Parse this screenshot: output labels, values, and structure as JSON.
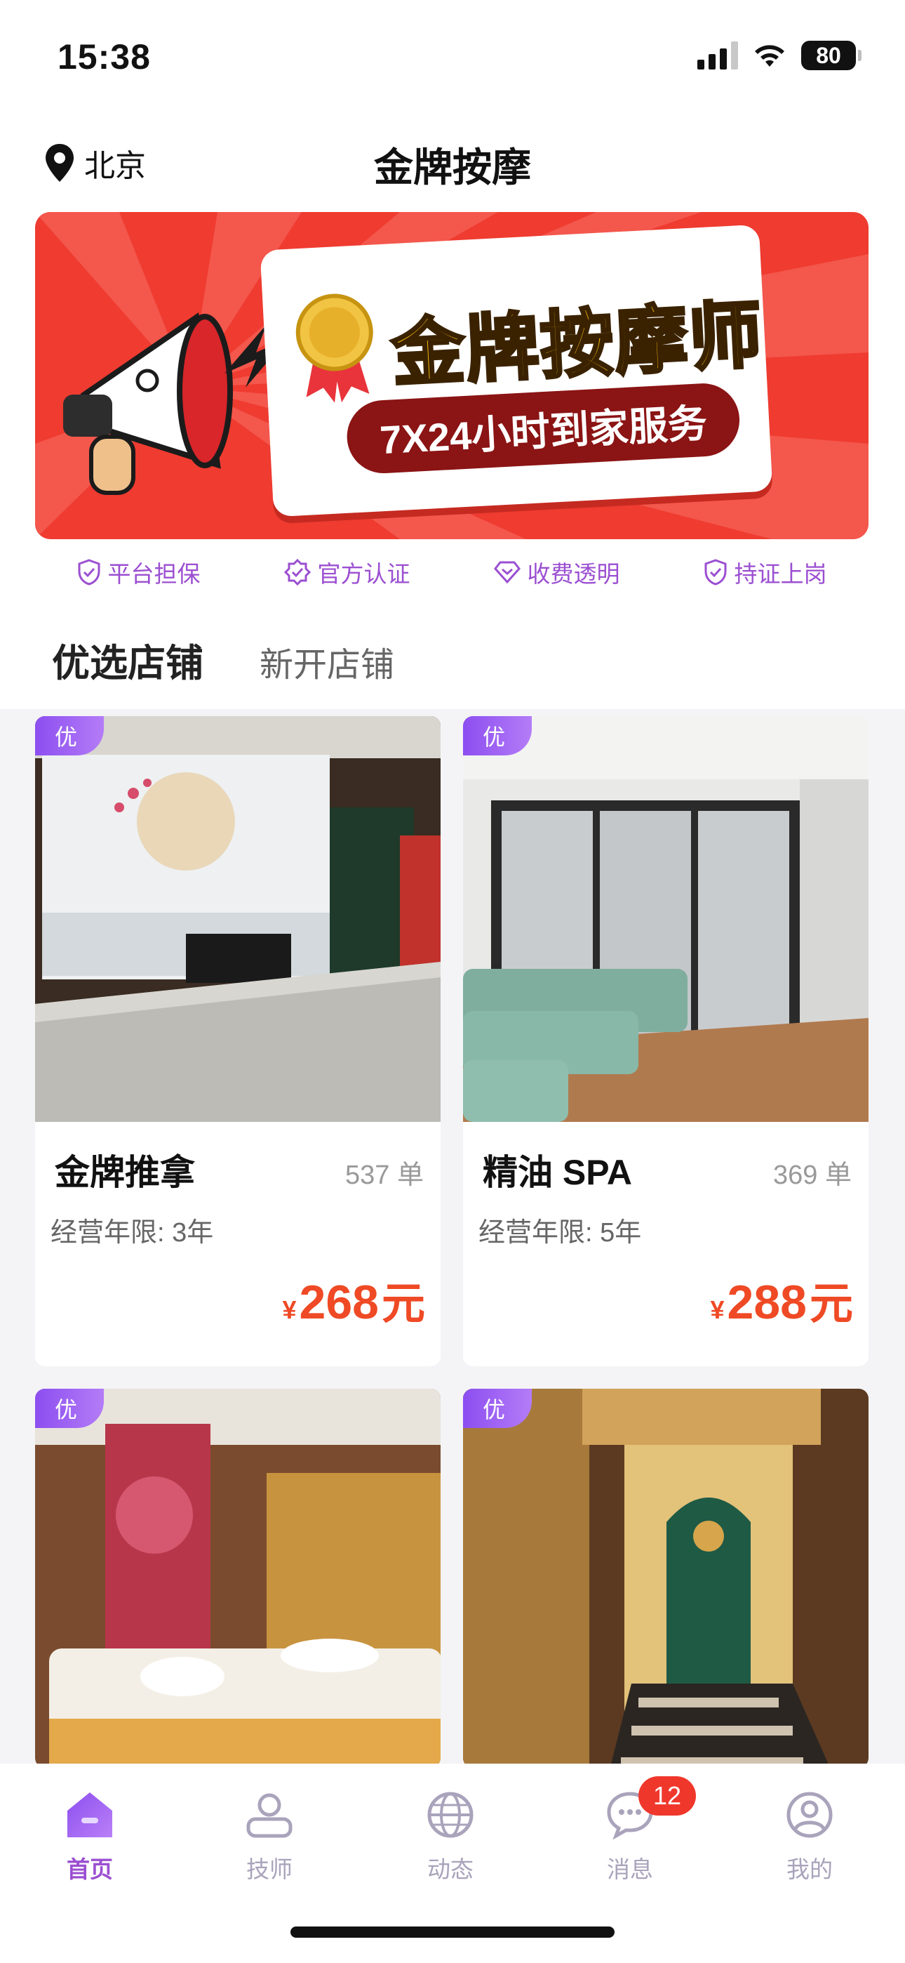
{
  "status_bar": {
    "time": "15:38",
    "battery": "80"
  },
  "nav": {
    "location": "北京",
    "title": "金牌按摩"
  },
  "banner": {
    "title": "金牌按摩师",
    "subtitle": "7X24小时到家服务"
  },
  "guarantees": [
    {
      "label": "平台担保",
      "icon": "shield-check-icon"
    },
    {
      "label": "官方认证",
      "icon": "certified-badge-icon"
    },
    {
      "label": "收费透明",
      "icon": "diamond-icon"
    },
    {
      "label": "持证上岗",
      "icon": "shield-check-icon"
    }
  ],
  "tabs": {
    "active": "优选店铺",
    "inactive": "新开店铺"
  },
  "shops": [
    {
      "badge": "优",
      "name": "金牌推拿",
      "orders": "537 单",
      "years": "经营年限: 3年",
      "currency": "¥",
      "price": "268",
      "unit": "元"
    },
    {
      "badge": "优",
      "name": "精油 SPA",
      "orders": "369 单",
      "years": "经营年限: 5年",
      "currency": "¥",
      "price": "288",
      "unit": "元"
    },
    {
      "badge": "优"
    },
    {
      "badge": "优"
    }
  ],
  "tabbar": {
    "items": [
      {
        "label": "首页",
        "icon": "home-icon",
        "active": true
      },
      {
        "label": "技师",
        "icon": "person-icon"
      },
      {
        "label": "动态",
        "icon": "globe-icon"
      },
      {
        "label": "消息",
        "icon": "chat-bubble-icon",
        "badge": "12"
      },
      {
        "label": "我的",
        "icon": "profile-circle-icon"
      }
    ]
  },
  "colors": {
    "accent": "#9b4fd1",
    "price": "#ef4a25",
    "banner_red": "#ef3b30",
    "badge_red": "#f0372c"
  }
}
